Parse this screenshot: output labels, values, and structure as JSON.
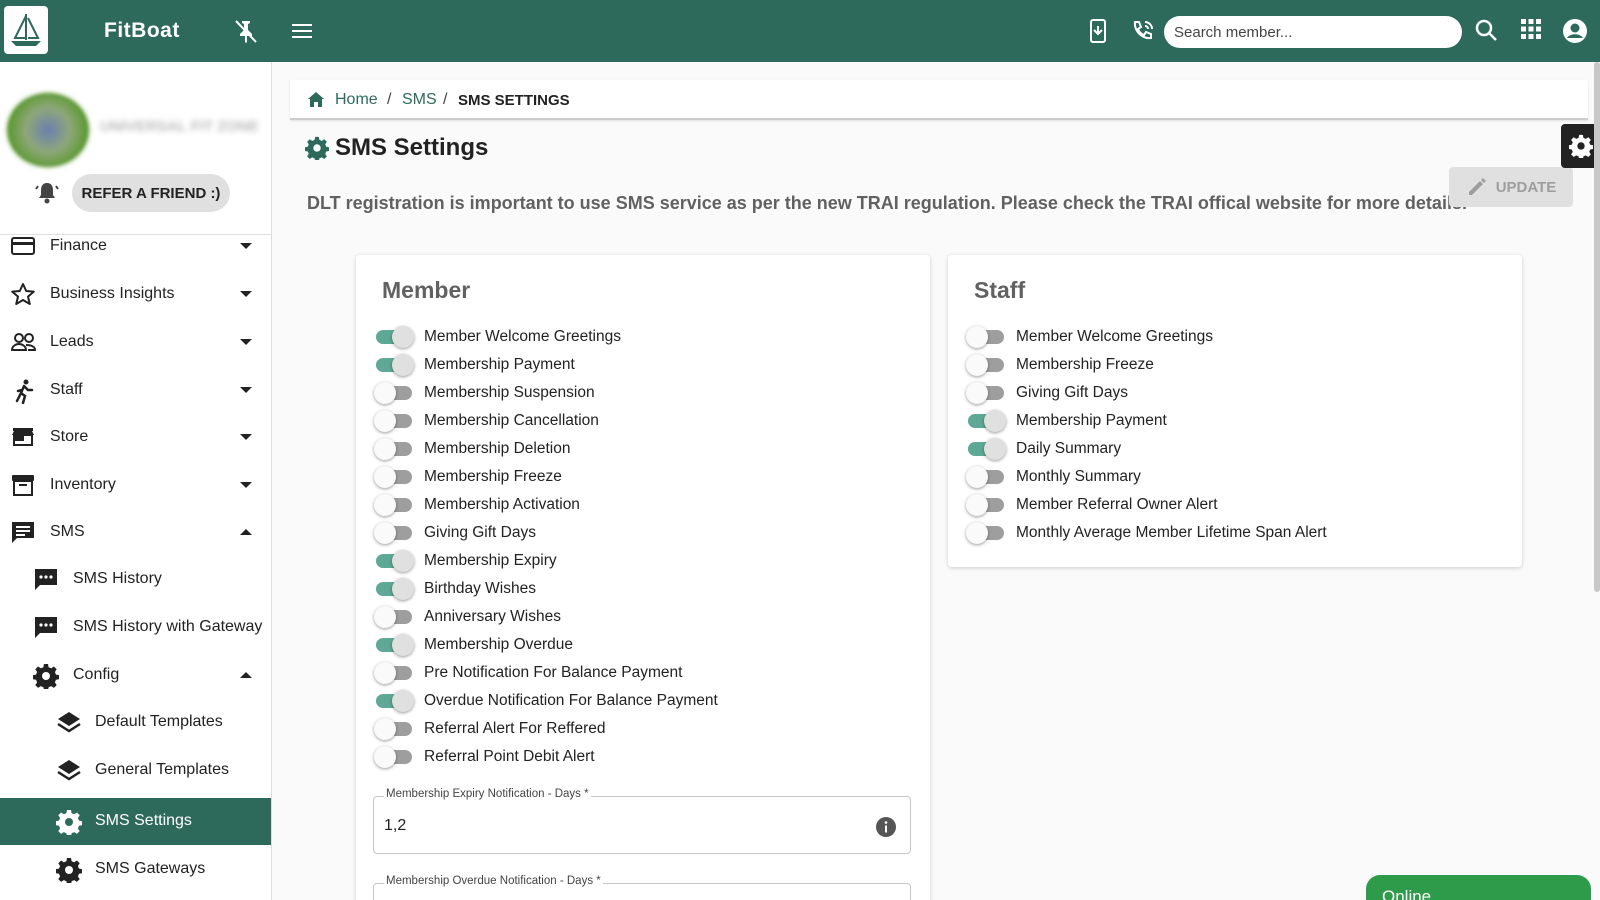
{
  "app": {
    "name": "FitBoat"
  },
  "topbar": {
    "search_placeholder": "Search member..."
  },
  "sidebar": {
    "org_name": "UNIVERSAL FIT ZONE",
    "refer_label": "REFER A FRIEND :)",
    "items": [
      {
        "label": "Finance",
        "icon": "credit-card-icon",
        "expanded": false
      },
      {
        "label": "Business Insights",
        "icon": "star-icon",
        "expanded": false
      },
      {
        "label": "Leads",
        "icon": "people-icon",
        "expanded": false
      },
      {
        "label": "Staff",
        "icon": "runner-icon",
        "expanded": false
      },
      {
        "label": "Store",
        "icon": "store-icon",
        "expanded": false
      },
      {
        "label": "Inventory",
        "icon": "archive-icon",
        "expanded": false
      },
      {
        "label": "SMS",
        "icon": "message-icon",
        "expanded": true
      },
      {
        "label": "SMS History",
        "icon": "chat-icon"
      },
      {
        "label": "SMS History with Gateway",
        "icon": "chat-icon"
      },
      {
        "label": "Config",
        "icon": "gear-icon",
        "expanded": true
      },
      {
        "label": "Default Templates",
        "icon": "layers-icon"
      },
      {
        "label": "General Templates",
        "icon": "layers-icon"
      },
      {
        "label": "SMS Settings",
        "icon": "gear-icon",
        "active": true
      },
      {
        "label": "SMS Gateways",
        "icon": "gear-icon"
      }
    ]
  },
  "breadcrumb": {
    "home": "Home",
    "sep": "/",
    "sms": "SMS",
    "current": "SMS SETTINGS"
  },
  "page": {
    "title": "SMS Settings",
    "notice": "DLT registration is important to use SMS service as per the new TRAI regulation. Please check the TRAI offical website for more details.",
    "update_label": "UPDATE"
  },
  "member": {
    "title": "Member",
    "toggles": [
      {
        "label": "Member Welcome Greetings",
        "on": true
      },
      {
        "label": "Membership Payment",
        "on": true
      },
      {
        "label": "Membership Suspension",
        "on": false
      },
      {
        "label": "Membership Cancellation",
        "on": false
      },
      {
        "label": "Membership Deletion",
        "on": false
      },
      {
        "label": "Membership Freeze",
        "on": false
      },
      {
        "label": "Membership Activation",
        "on": false
      },
      {
        "label": "Giving Gift Days",
        "on": false
      },
      {
        "label": "Membership Expiry",
        "on": true
      },
      {
        "label": "Birthday Wishes",
        "on": true
      },
      {
        "label": "Anniversary Wishes",
        "on": false
      },
      {
        "label": "Membership Overdue",
        "on": true
      },
      {
        "label": "Pre Notification For Balance Payment",
        "on": false
      },
      {
        "label": "Overdue Notification For Balance Payment",
        "on": true
      },
      {
        "label": "Referral Alert For Reffered",
        "on": false
      },
      {
        "label": "Referral Point Debit Alert",
        "on": false
      }
    ],
    "expiry_field": {
      "label": "Membership Expiry Notification - Days *",
      "value": "1,2"
    },
    "overdue_field": {
      "label": "Membership Overdue Notification - Days *",
      "value": ""
    }
  },
  "staff": {
    "title": "Staff",
    "toggles": [
      {
        "label": "Member Welcome Greetings",
        "on": false
      },
      {
        "label": "Membership Freeze",
        "on": false
      },
      {
        "label": "Giving Gift Days",
        "on": false
      },
      {
        "label": "Membership Payment",
        "on": true
      },
      {
        "label": "Daily Summary",
        "on": true
      },
      {
        "label": "Monthly Summary",
        "on": false
      },
      {
        "label": "Member Referral Owner Alert",
        "on": false
      },
      {
        "label": "Monthly Average Member Lifetime Span Alert",
        "on": false
      }
    ]
  },
  "status": {
    "online_label": "Online"
  },
  "colors": {
    "primary": "#2d6a5c",
    "toggle_on": "#5fa896",
    "online": "#2e9b4a"
  }
}
